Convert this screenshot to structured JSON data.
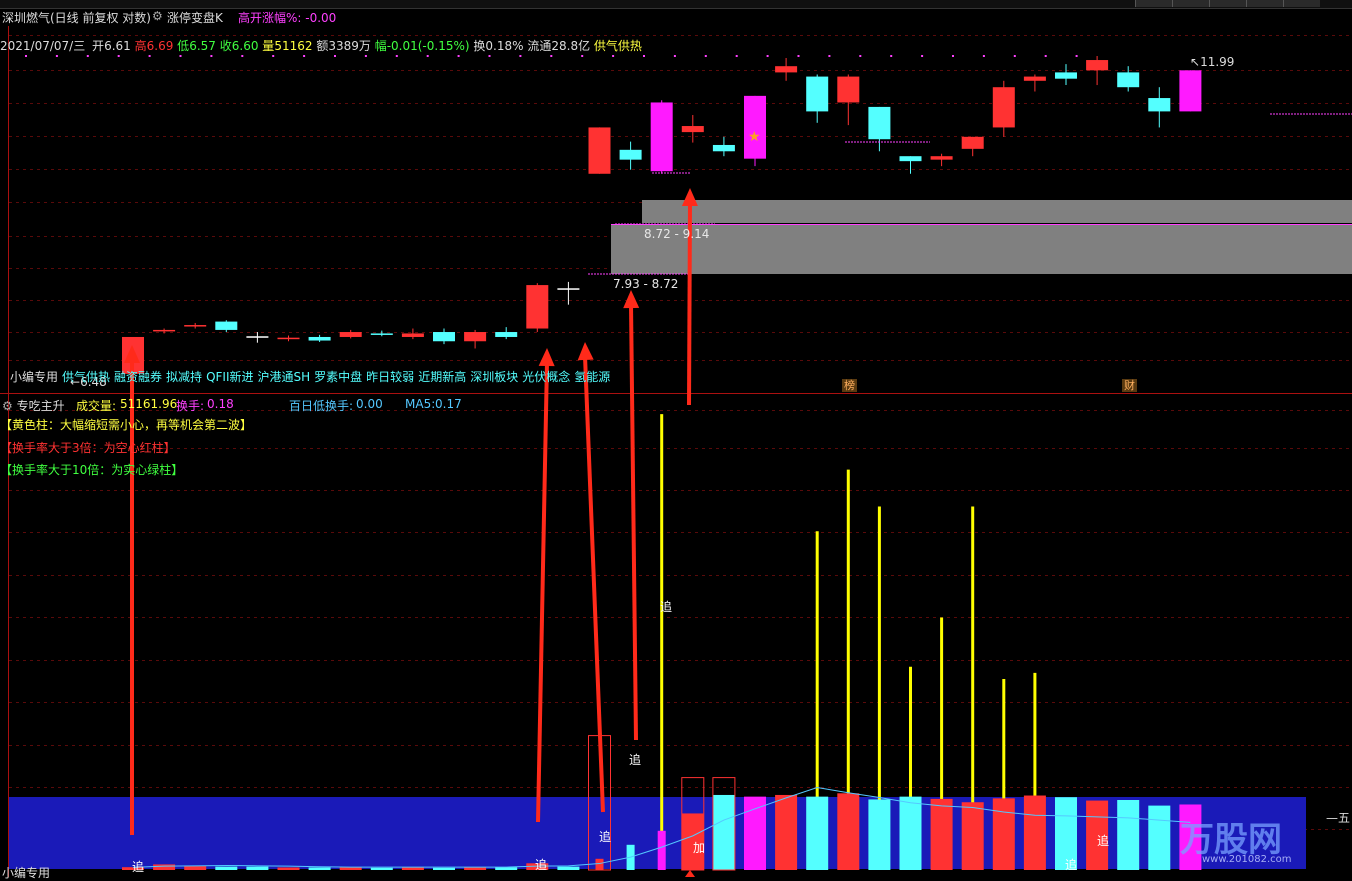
{
  "header": {
    "stock": "深圳燃气(日线 前复权 对数)",
    "indicator": "涨停变盘K",
    "gap": "高开涨幅%: -0.00"
  },
  "quote": {
    "date": "2021/07/07/三",
    "open_label": "开",
    "open": "6.61",
    "high_label": "高",
    "high": "6.69",
    "low_label": "低",
    "low": "6.57",
    "close_label": "收",
    "close": "6.60",
    "vol_label": "量",
    "vol": "51162",
    "amt": "额3389万",
    "chg": "幅-0.01(-0.15%)",
    "turn": "换0.18%",
    "float": "流通28.8亿",
    "concept": "供气供热"
  },
  "price_labels": {
    "high_mark": "11.99",
    "low_mark": "6.48",
    "zone_upper": "8.72 - 9.14",
    "zone_lower": "7.93 - 8.72"
  },
  "tags_row": [
    "小编专用",
    "供气供热",
    "融资融券",
    "拟减持",
    "QFII新进",
    "沪港通SH",
    "罗素中盘",
    "昨日较弱",
    "近期新高",
    "深圳板块",
    "光伏概念",
    "氢能源"
  ],
  "badges": {
    "bang": "榜",
    "cai": "财"
  },
  "sub_panel": {
    "name": "专吃主升",
    "vol_label": "成交量:",
    "vol": "51161.96",
    "turn_label": "换手:",
    "turn": "0.18",
    "low_turn_label": "百日低换手:",
    "low_turn": "0.00",
    "ma5_label": "MA5:",
    "ma5": "0.17",
    "note1": "【黄色柱：大幅缩短需小心，再等机会第二波】",
    "note2": "【换手率大于3倍：为空心红柱】",
    "note3": "【换手率大于10倍：为实心绿柱】",
    "five_day": "五日",
    "bottom_tag": "小编专用",
    "markers": {
      "zhui": "追",
      "jia": "加"
    }
  },
  "watermark": {
    "brand": "万股网",
    "url": "www.201082.com"
  },
  "colors": {
    "up": "#ff3232",
    "down": "#54ffff",
    "magenta": "#ff1aff",
    "yellow": "#ffff00",
    "arrow": "#ff2a1a",
    "zone": "#808080",
    "blue_band": "#1a1ab8"
  },
  "chart_data": {
    "type": "candlestick",
    "scale": "log",
    "candles": [
      {
        "o": 6.48,
        "h": 6.98,
        "l": 6.48,
        "c": 6.98,
        "color": "up"
      },
      {
        "o": 7.06,
        "h": 7.1,
        "l": 7.03,
        "c": 7.08,
        "color": "up"
      },
      {
        "o": 7.13,
        "h": 7.18,
        "l": 7.1,
        "c": 7.15,
        "color": "up"
      },
      {
        "o": 7.2,
        "h": 7.22,
        "l": 7.05,
        "c": 7.08,
        "color": "down"
      },
      {
        "o": 6.99,
        "h": 7.05,
        "l": 6.9,
        "c": 6.99,
        "color": "doji"
      },
      {
        "o": 6.95,
        "h": 7.0,
        "l": 6.92,
        "c": 6.97,
        "color": "up"
      },
      {
        "o": 6.98,
        "h": 7.01,
        "l": 6.91,
        "c": 6.93,
        "color": "down"
      },
      {
        "o": 6.98,
        "h": 7.08,
        "l": 6.96,
        "c": 7.05,
        "color": "up"
      },
      {
        "o": 7.03,
        "h": 7.07,
        "l": 6.99,
        "c": 7.01,
        "color": "down"
      },
      {
        "o": 6.98,
        "h": 7.1,
        "l": 6.95,
        "c": 7.03,
        "color": "up"
      },
      {
        "o": 7.05,
        "h": 7.1,
        "l": 6.88,
        "c": 6.92,
        "color": "down"
      },
      {
        "o": 6.92,
        "h": 7.08,
        "l": 6.82,
        "c": 7.05,
        "color": "up"
      },
      {
        "o": 7.05,
        "h": 7.12,
        "l": 6.95,
        "c": 6.98,
        "color": "down"
      },
      {
        "o": 7.1,
        "h": 7.78,
        "l": 7.05,
        "c": 7.75,
        "color": "up"
      },
      {
        "o": 7.7,
        "h": 7.8,
        "l": 7.45,
        "c": 7.7,
        "color": "doji"
      },
      {
        "o": 9.7,
        "h": 10.65,
        "l": 9.7,
        "c": 10.65,
        "color": "up"
      },
      {
        "o": 10.18,
        "h": 10.35,
        "l": 9.78,
        "c": 9.98,
        "color": "down"
      },
      {
        "o": 9.75,
        "h": 11.25,
        "l": 9.7,
        "c": 11.2,
        "color": "magenta"
      },
      {
        "o": 10.55,
        "h": 10.92,
        "l": 10.33,
        "c": 10.68,
        "color": "up"
      },
      {
        "o": 10.28,
        "h": 10.45,
        "l": 10.05,
        "c": 10.15,
        "color": "down"
      },
      {
        "o": 10.0,
        "h": 11.35,
        "l": 9.85,
        "c": 11.35,
        "color": "magenta"
      },
      {
        "o": 11.9,
        "h": 12.25,
        "l": 11.7,
        "c": 12.05,
        "color": "up"
      },
      {
        "o": 11.8,
        "h": 11.85,
        "l": 10.75,
        "c": 11.0,
        "color": "down"
      },
      {
        "o": 11.2,
        "h": 11.85,
        "l": 10.7,
        "c": 11.8,
        "color": "up"
      },
      {
        "o": 11.1,
        "h": 11.1,
        "l": 10.15,
        "c": 10.4,
        "color": "down"
      },
      {
        "o": 10.05,
        "h": 10.05,
        "l": 9.7,
        "c": 9.95,
        "color": "down"
      },
      {
        "o": 9.98,
        "h": 10.1,
        "l": 9.85,
        "c": 10.05,
        "color": "up"
      },
      {
        "o": 10.2,
        "h": 10.45,
        "l": 10.05,
        "c": 10.45,
        "color": "up"
      },
      {
        "o": 10.65,
        "h": 11.7,
        "l": 10.45,
        "c": 11.55,
        "color": "up"
      },
      {
        "o": 11.7,
        "h": 11.85,
        "l": 11.45,
        "c": 11.8,
        "color": "up"
      },
      {
        "o": 11.9,
        "h": 12.1,
        "l": 11.6,
        "c": 11.75,
        "color": "down"
      },
      {
        "o": 11.95,
        "h": 12.3,
        "l": 11.6,
        "c": 12.2,
        "color": "up"
      },
      {
        "o": 11.9,
        "h": 12.05,
        "l": 11.45,
        "c": 11.55,
        "color": "down"
      },
      {
        "o": 11.3,
        "h": 11.55,
        "l": 10.65,
        "c": 11.0,
        "color": "down"
      },
      {
        "o": 11.0,
        "h": 11.95,
        "l": 11.0,
        "c": 11.95,
        "color": "magenta"
      }
    ],
    "turnover_bars": [
      0.1,
      0.2,
      0.14,
      0.12,
      0.12,
      0.09,
      0.09,
      0.09,
      0.08,
      0.09,
      0.08,
      0.1,
      0.1,
      0.24,
      0.12,
      0.4,
      0.9,
      1.4,
      2.02,
      2.68,
      2.62,
      2.68,
      2.62,
      2.74,
      2.52,
      2.62,
      2.54,
      2.42,
      2.56,
      2.66,
      2.6,
      2.48,
      2.5,
      2.3,
      2.34
    ],
    "yellow_lines": {
      "17": 7.4,
      "22": 5.5,
      "23": 6.5,
      "24": 5.9,
      "25": 3.3,
      "26": 4.1,
      "27": 5.9,
      "28": 3.1,
      "29": 3.2
    },
    "ma5": [
      0.08,
      0.12,
      0.13,
      0.14,
      0.13,
      0.12,
      0.1,
      0.09,
      0.09,
      0.09,
      0.09,
      0.09,
      0.09,
      0.12,
      0.13,
      0.2,
      0.4,
      0.71,
      1.06,
      1.55,
      1.9,
      2.24,
      2.56,
      2.4,
      2.25,
      2.09,
      1.99,
      1.94,
      1.8,
      1.7,
      1.68,
      1.65,
      1.62,
      1.55,
      1.48
    ]
  }
}
